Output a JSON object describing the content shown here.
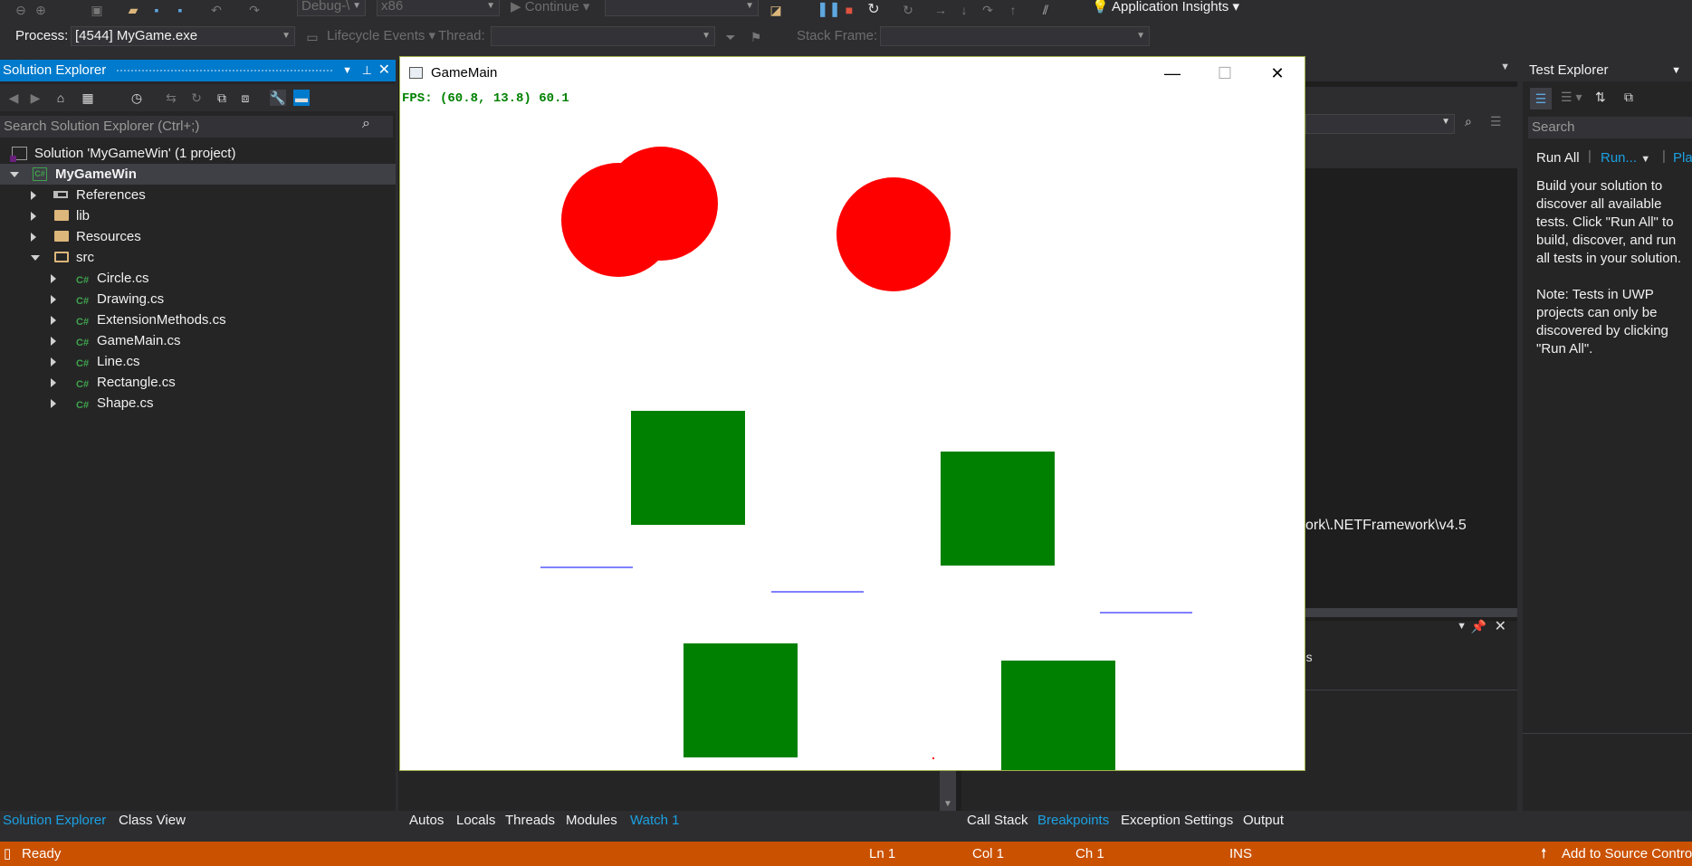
{
  "toolbar": {
    "config_combo": "Debug-\\",
    "platform_combo": "x86",
    "continue_label": "Continue",
    "app_insights": "Application Insights",
    "process_label": "Process:",
    "process_value": "[4544] MyGame.exe",
    "lifecycle_label": "Lifecycle Events",
    "thread_label": "Thread:",
    "stack_frame_label": "Stack Frame:"
  },
  "solution_explorer": {
    "title": "Solution Explorer",
    "search_placeholder": "Search Solution Explorer (Ctrl+;)",
    "solution": "Solution 'MyGameWin' (1 project)",
    "project": "MyGameWin",
    "items": [
      "References",
      "lib",
      "Resources",
      "src"
    ],
    "files": [
      "Circle.cs",
      "Drawing.cs",
      "ExtensionMethods.cs",
      "GameMain.cs",
      "Line.cs",
      "Rectangle.cs",
      "Shape.cs"
    ],
    "tabs": [
      "Solution Explorer",
      "Class View"
    ]
  },
  "game_window": {
    "title": "GameMain",
    "fps_text": "FPS: (60.8, 13.8) 60.1",
    "circle_color": "#ff0000",
    "rect_color": "#008000",
    "line_color": "#0000ff"
  },
  "debug_tabs_left": [
    "Autos",
    "Locals",
    "Threads",
    "Modules",
    "Watch 1"
  ],
  "debug_tabs_right": [
    "Call Stack",
    "Breakpoints",
    "Exception Settings",
    "Output"
  ],
  "output_path": "ork\\.NETFramework\\v4.5",
  "right_fragment": "ans",
  "test_explorer": {
    "title": "Test Explorer",
    "search_placeholder": "Search",
    "run_all": "Run All",
    "run": "Run...",
    "playlist": "Pla",
    "message": "Build your solution to discover all available tests. Click \"Run All\" to build, discover, and run all tests in your solution.\n\nNote: Tests in UWP projects can only be discovered by clicking \"Run All\"."
  },
  "status_bar": {
    "ready": "Ready",
    "ln": "Ln 1",
    "col": "Col 1",
    "ch": "Ch 1",
    "ins": "INS",
    "source_control": "Add to Source Control"
  },
  "accent_color": "#007acc",
  "status_color": "#ca5100"
}
